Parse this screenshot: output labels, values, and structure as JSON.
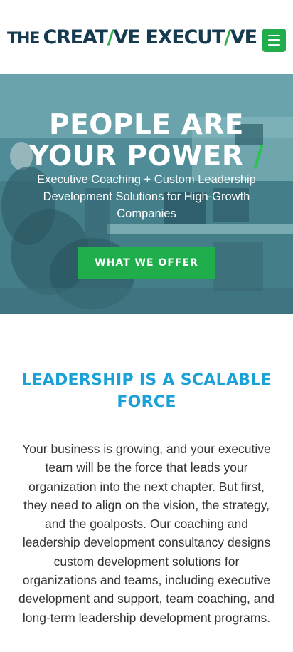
{
  "header": {
    "logo_the": "THE",
    "logo_creat": "CREAT",
    "logo_slash1": "/",
    "logo_ve1": "VE EXECUT",
    "logo_slash2": "/",
    "logo_ve2": "VE",
    "menu_icon": "hamburger-menu-icon"
  },
  "hero": {
    "title_line1": "PEOPLE ARE",
    "title_line2": "YOUR POWER",
    "title_slash": "/",
    "subtitle": "Executive Coaching + Custom Leadership Development Solutions for High-Growth Companies",
    "cta_label": "WHAT WE OFFER"
  },
  "section": {
    "title": "LEADERSHIP IS A SCALABLE FORCE",
    "body": "Your business is growing, and your executive team will be the force that leads your organization into the next chapter. But first, they need to align on the vision, the strategy, and the goalposts. Our coaching and leadership development consultancy designs custom development solutions for organizations and teams, including executive development and support, team coaching, and long-term leadership development programs."
  },
  "colors": {
    "brand_dark": "#163a4f",
    "brand_green": "#20ad4b",
    "heading_blue": "#1aa2d8",
    "hero_tint": "#4f8994"
  }
}
